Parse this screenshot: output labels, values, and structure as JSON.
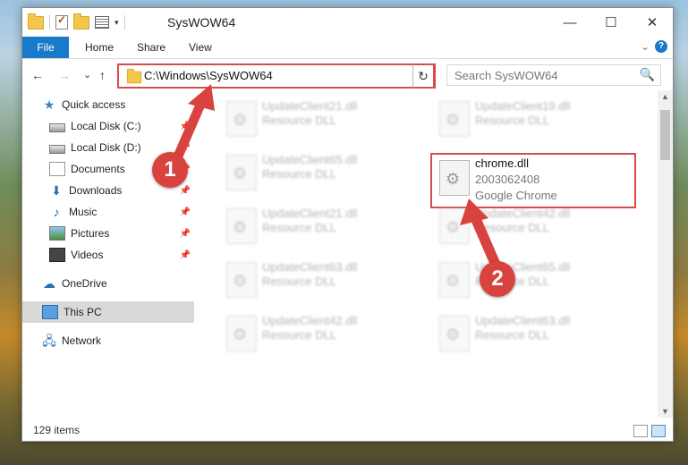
{
  "window": {
    "title": "SysWOW64",
    "minimize": "—",
    "maximize": "☐",
    "close": "✕"
  },
  "ribbon": {
    "tabs": [
      "File",
      "Home",
      "Share",
      "View"
    ],
    "collapse": "⌄",
    "help": "?"
  },
  "nav": {
    "back": "←",
    "forward": "→",
    "recent": "⌄",
    "up": "↑",
    "address": "C:\\Windows\\SysWOW64",
    "address_dropdown": "⌄",
    "refresh": "↻",
    "search_placeholder": "Search SysWOW64",
    "search_icon": "🔍"
  },
  "sidebar": {
    "items": [
      {
        "label": "Quick access",
        "icon": "star-icon"
      },
      {
        "label": "Local Disk (C:)",
        "icon": "drive-icon"
      },
      {
        "label": "Local Disk (D:)",
        "icon": "drive-icon"
      },
      {
        "label": "Documents",
        "icon": "documents-icon"
      },
      {
        "label": "Downloads",
        "icon": "downloads-icon"
      },
      {
        "label": "Music",
        "icon": "music-icon"
      },
      {
        "label": "Pictures",
        "icon": "pictures-icon"
      },
      {
        "label": "Videos",
        "icon": "videos-icon"
      },
      {
        "label": "OneDrive",
        "icon": "cloud-icon"
      },
      {
        "label": "This PC",
        "icon": "pc-icon"
      },
      {
        "label": "Network",
        "icon": "network-icon"
      }
    ],
    "pin": "📌"
  },
  "files": {
    "left": [
      {
        "name": "UpdateClient21.dll",
        "type": "Resource DLL"
      },
      {
        "name": "UpdateClient65.dll",
        "type": "Resource DLL"
      },
      {
        "name": "UpdateClient21.dll",
        "type": "Resource DLL"
      },
      {
        "name": "UpdateClient63.dll",
        "type": "Resource DLL"
      },
      {
        "name": "UpdateClient42.dll",
        "type": "Resource DLL"
      }
    ],
    "right": [
      {
        "name": "UpdateClient19.dll",
        "type": "Resource DLL"
      },
      {
        "name": "UpdateClient42.dll",
        "type": "Resource DLL"
      },
      {
        "name": "UpdateClient65.dll",
        "type": "Resource DLL"
      },
      {
        "name": "UpdateClient63.dll",
        "type": "Resource DLL"
      }
    ],
    "highlight": {
      "name": "chrome.dll",
      "version": "2003062408",
      "company": "Google Chrome"
    }
  },
  "status": {
    "count": "129 items"
  },
  "markers": {
    "one": "1",
    "two": "2"
  },
  "colors": {
    "accent": "#1979ca",
    "highlight": "#d94a4a"
  }
}
